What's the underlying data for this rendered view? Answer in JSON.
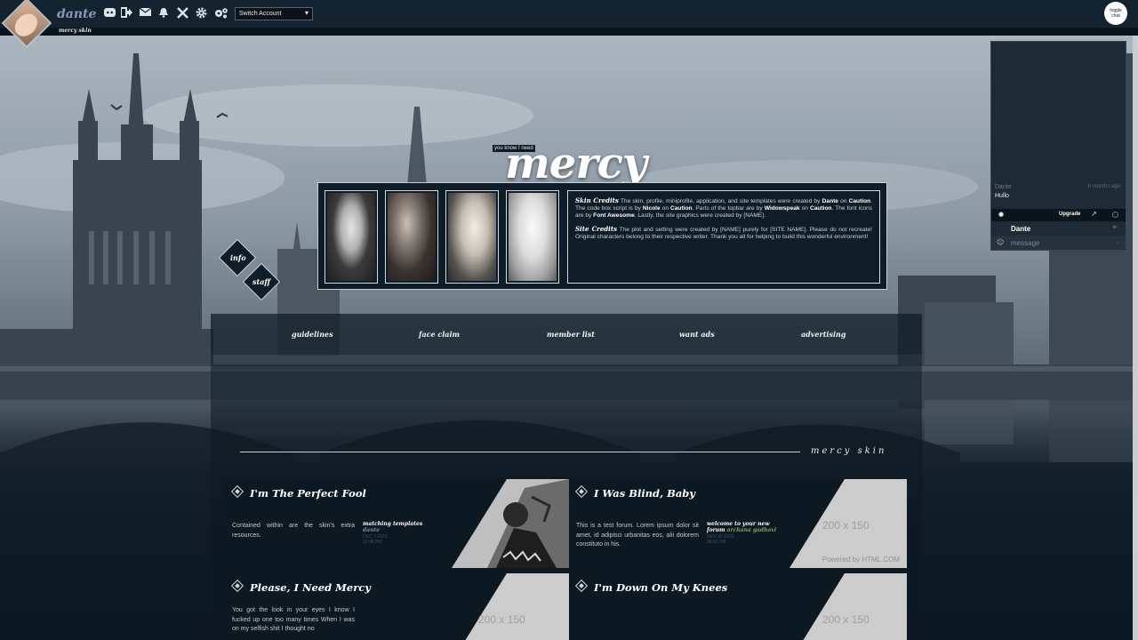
{
  "topbar": {
    "username": "dante",
    "skin_name": "mercy skin",
    "icons": [
      "discord-icon",
      "logout-icon",
      "envelope-icon",
      "bell-icon",
      "tools-icon",
      "gear-icon",
      "cogs-icon"
    ],
    "switch_account": "Switch Account",
    "toggle_chat": [
      "toggle",
      "chat"
    ]
  },
  "header": {
    "tagline": "you know I need",
    "title": "mercy",
    "nav_diamonds": [
      "info",
      "staff"
    ],
    "credits": {
      "skin_heading": "Skin Credits",
      "skin_parts": [
        "The skin, profile, miniprofile, application, and site templates were created by ",
        "Dante",
        " on ",
        "Caution",
        ". The code box script is by ",
        "Nicole",
        " on ",
        "Caution",
        ". Parts of the topbar are by ",
        "Widowspeak",
        " on ",
        "Caution",
        ". The font icons are by ",
        "Font Awesome",
        ". Lastly, the site graphics were created by [NAME]."
      ],
      "site_heading": "Site Credits",
      "site_text": "The plot and setting were created by [NAME] purely for [SITE NAME]. Please do not recreate! Original characters belong to their respective writer. Thank you all for helping to build this wonderful environment!"
    }
  },
  "nav": [
    "guidelines",
    "face claim",
    "member list",
    "want ads",
    "advertising"
  ],
  "category": {
    "title": "mercy skin"
  },
  "forums": [
    {
      "title": "I'm The Perfect Fool",
      "description": "Contained within are the skin's extra resources.",
      "last_post_title": "matching templates",
      "last_post_by": "dante",
      "last_post_date": "DEC 7 2020,",
      "last_post_time": "12:08 PM",
      "image_label": ""
    },
    {
      "title": "I Was Blind, Baby",
      "description": "This is a test forum. Lorem ipsum dolor sit amet, id adipisci urbanitas eos, alii dolorem constituto in his.",
      "last_post_title": "welcome to your new forum",
      "last_post_by": "archana gadhavi",
      "last_post_date": "NOV 30 2020,",
      "last_post_time": "08:53 PM",
      "image_label": "200 x 150",
      "powered_by": "Powered by HTML.COM"
    },
    {
      "title": "Please, I Need Mercy",
      "description": "You got the look in your eyes I know I fucked up one too many times When I was on my selfish shit I thought no",
      "last_post_title": "",
      "last_post_by": "",
      "last_post_date": "",
      "last_post_time": "",
      "image_label": "200 x 150"
    },
    {
      "title": "I'm Down On My Knees",
      "description": "",
      "last_post_title": "",
      "last_post_by": "",
      "last_post_date": "",
      "last_post_time": "",
      "image_label": "200 x 150"
    }
  ],
  "chatbox": {
    "message_author": "Dante",
    "message_time": "6 months ago",
    "message_text": "Hullo",
    "upgrade_label": "Upgrade",
    "current_user": "Dante",
    "input_placeholder": "message"
  },
  "colors": {
    "accent": "#7fa35b",
    "panel": "#0c1822",
    "border": "#c7ced4"
  }
}
